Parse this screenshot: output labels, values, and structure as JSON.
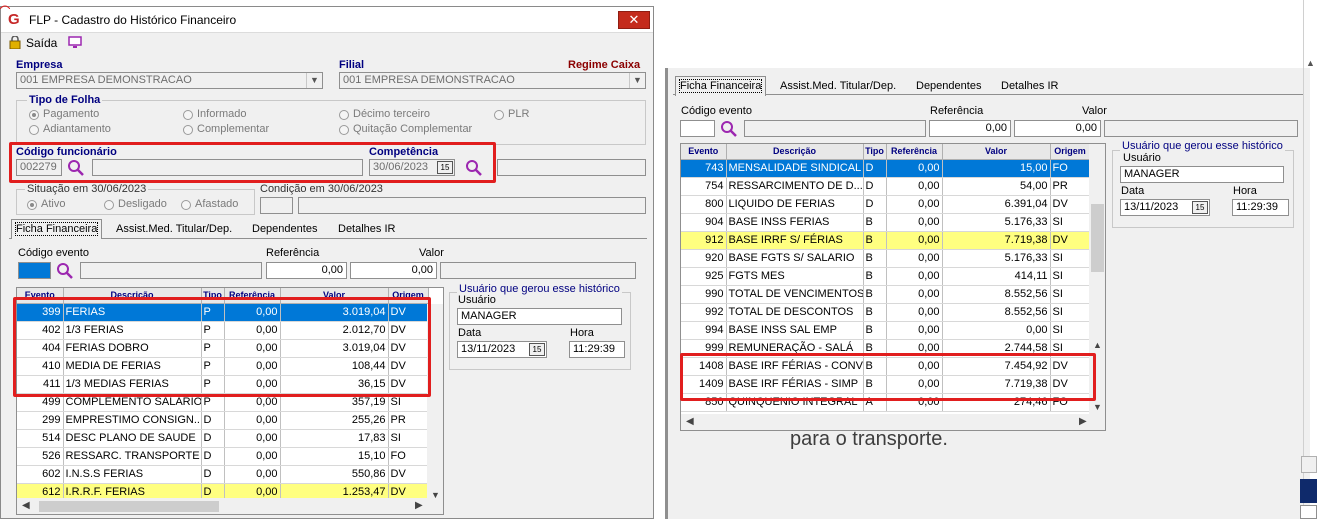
{
  "window": {
    "title": "FLP - Cadastro do Histórico Financeiro",
    "close": "✕",
    "logo": "G"
  },
  "toolbar": {
    "exit_label": "Saída"
  },
  "empresa": {
    "label": "Empresa",
    "value": "001 EMPRESA DEMONSTRACAO"
  },
  "filial": {
    "label": "Filial",
    "value": "001 EMPRESA DEMONSTRACAO",
    "regime": "Regime Caixa"
  },
  "tipo_folha": {
    "label": "Tipo de Folha",
    "options": [
      "Pagamento",
      "Informado",
      "Décimo terceiro",
      "PLR",
      "Adiantamento",
      "Complementar",
      "Quitação Complementar"
    ],
    "selected": "Pagamento"
  },
  "codigo_funcionario": {
    "label": "Código funcionário",
    "value": "002279"
  },
  "competencia": {
    "label": "Competência",
    "value": "30/06/2023",
    "cal": "15"
  },
  "situacao": {
    "label": "Situação em  30/06/2023",
    "options": [
      "Ativo",
      "Desligado",
      "Afastado"
    ],
    "selected": "Ativo"
  },
  "condicao": {
    "label": "Condição em 30/06/2023"
  },
  "tabs": [
    "Ficha Financeira",
    "Assist.Med. Titular/Dep.",
    "Dependentes",
    "Detalhes IR"
  ],
  "entry": {
    "codigo_label": "Código evento",
    "referencia_label": "Referência",
    "valor_label": "Valor",
    "referencia_value": "0,00",
    "valor_value": "0,00"
  },
  "grid_headers": [
    "Evento",
    "Descrição",
    "Tipo",
    "Referência",
    "Valor",
    "Origem"
  ],
  "left_grid": [
    {
      "evento": "399",
      "descricao": "FERIAS",
      "tipo": "P",
      "referencia": "0,00",
      "valor": "3.019,04",
      "origem": "DV",
      "style": "sel"
    },
    {
      "evento": "402",
      "descricao": "1/3 FERIAS",
      "tipo": "P",
      "referencia": "0,00",
      "valor": "2.012,70",
      "origem": "DV",
      "style": ""
    },
    {
      "evento": "404",
      "descricao": "FERIAS DOBRO",
      "tipo": "P",
      "referencia": "0,00",
      "valor": "3.019,04",
      "origem": "DV",
      "style": ""
    },
    {
      "evento": "410",
      "descricao": "MEDIA DE FERIAS",
      "tipo": "P",
      "referencia": "0,00",
      "valor": "108,44",
      "origem": "DV",
      "style": ""
    },
    {
      "evento": "411",
      "descricao": "1/3 MEDIAS FERIAS",
      "tipo": "P",
      "referencia": "0,00",
      "valor": "36,15",
      "origem": "DV",
      "style": ""
    },
    {
      "evento": "499",
      "descricao": "COMPLEMENTO SALÁRIO",
      "tipo": "P",
      "referencia": "0,00",
      "valor": "357,19",
      "origem": "SI",
      "style": ""
    },
    {
      "evento": "299",
      "descricao": "EMPRESTIMO CONSIGN...",
      "tipo": "D",
      "referencia": "0,00",
      "valor": "255,26",
      "origem": "PR",
      "style": ""
    },
    {
      "evento": "514",
      "descricao": "DESC PLANO DE SAUDE",
      "tipo": "D",
      "referencia": "0,00",
      "valor": "17,83",
      "origem": "SI",
      "style": ""
    },
    {
      "evento": "526",
      "descricao": "RESSARC. TRANSPORTE",
      "tipo": "D",
      "referencia": "0,00",
      "valor": "15,10",
      "origem": "FO",
      "style": ""
    },
    {
      "evento": "602",
      "descricao": "I.N.S.S FERIAS",
      "tipo": "D",
      "referencia": "0,00",
      "valor": "550,86",
      "origem": "DV",
      "style": ""
    },
    {
      "evento": "612",
      "descricao": "I.R.R.F. FERIAS",
      "tipo": "D",
      "referencia": "0,00",
      "valor": "1.253,47",
      "origem": "DV",
      "style": "yel"
    }
  ],
  "right_grid": [
    {
      "evento": "743",
      "descricao": "MENSALIDADE SINDICAL",
      "tipo": "D",
      "referencia": "0,00",
      "valor": "15,00",
      "origem": "FO",
      "style": "sel"
    },
    {
      "evento": "754",
      "descricao": "RESSARCIMENTO DE D...",
      "tipo": "D",
      "referencia": "0,00",
      "valor": "54,00",
      "origem": "PR",
      "style": ""
    },
    {
      "evento": "800",
      "descricao": "LIQUIDO DE FERIAS",
      "tipo": "D",
      "referencia": "0,00",
      "valor": "6.391,04",
      "origem": "DV",
      "style": ""
    },
    {
      "evento": "904",
      "descricao": "BASE INSS FERIAS",
      "tipo": "B",
      "referencia": "0,00",
      "valor": "5.176,33",
      "origem": "SI",
      "style": ""
    },
    {
      "evento": "912",
      "descricao": "BASE IRRF S/ FÉRIAS",
      "tipo": "B",
      "referencia": "0,00",
      "valor": "7.719,38",
      "origem": "DV",
      "style": "yel"
    },
    {
      "evento": "920",
      "descricao": "BASE FGTS S/ SALARIO",
      "tipo": "B",
      "referencia": "0,00",
      "valor": "5.176,33",
      "origem": "SI",
      "style": ""
    },
    {
      "evento": "925",
      "descricao": "FGTS MES",
      "tipo": "B",
      "referencia": "0,00",
      "valor": "414,11",
      "origem": "SI",
      "style": ""
    },
    {
      "evento": "990",
      "descricao": "TOTAL DE VENCIMENTOS",
      "tipo": "B",
      "referencia": "0,00",
      "valor": "8.552,56",
      "origem": "SI",
      "style": ""
    },
    {
      "evento": "992",
      "descricao": "TOTAL DE DESCONTOS",
      "tipo": "B",
      "referencia": "0,00",
      "valor": "8.552,56",
      "origem": "SI",
      "style": ""
    },
    {
      "evento": "994",
      "descricao": "BASE INSS SAL EMP",
      "tipo": "B",
      "referencia": "0,00",
      "valor": "0,00",
      "origem": "SI",
      "style": ""
    },
    {
      "evento": "999",
      "descricao": "REMUNERAÇÃO - SALÁ",
      "tipo": "B",
      "referencia": "0,00",
      "valor": "2.744,58",
      "origem": "SI",
      "style": ""
    },
    {
      "evento": "1408",
      "descricao": "BASE IRF FÉRIAS - CONV",
      "tipo": "B",
      "referencia": "0,00",
      "valor": "7.454,92",
      "origem": "DV",
      "style": ""
    },
    {
      "evento": "1409",
      "descricao": "BASE IRF FÉRIAS - SIMP",
      "tipo": "B",
      "referencia": "0,00",
      "valor": "7.719,38",
      "origem": "DV",
      "style": ""
    },
    {
      "evento": "850",
      "descricao": "QUINQUENIO INTEGRAL",
      "tipo": "A",
      "referencia": "0,00",
      "valor": "274,46",
      "origem": "FO",
      "style": ""
    }
  ],
  "usuario_box": {
    "title": "Usuário que gerou esse histórico",
    "usuario_label": "Usuário",
    "usuario": "MANAGER",
    "data_label": "Data",
    "data": "13/11/2023",
    "hora_label": "Hora",
    "hora": "11:29:39"
  },
  "background_text": "para o transporte.",
  "colors": {
    "selection": "#0078d7",
    "highlight": "#ffff80",
    "annotation": "#e11e1e",
    "label_blue": "#000080",
    "regime": "#8b0000"
  }
}
